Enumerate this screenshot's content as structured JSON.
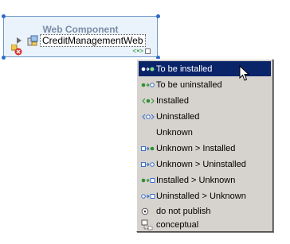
{
  "component": {
    "title": "Web Component",
    "name": "CreditManagementWeb"
  },
  "menu": {
    "items": [
      {
        "label": "To be installed",
        "icon": "to-be-installed-icon",
        "selected": true
      },
      {
        "label": "To be uninstalled",
        "icon": "to-be-uninstalled-icon",
        "selected": false
      },
      {
        "label": "Installed",
        "icon": "installed-icon",
        "selected": false
      },
      {
        "label": "Uninstalled",
        "icon": "uninstalled-icon",
        "selected": false
      },
      {
        "label": "Unknown",
        "icon": "",
        "selected": false
      },
      {
        "label": "Unknown > Installed",
        "icon": "unknown-installed-icon",
        "selected": false
      },
      {
        "label": "Unknown > Uninstalled",
        "icon": "unknown-uninstalled-icon",
        "selected": false
      },
      {
        "label": "Installed > Unknown",
        "icon": "installed-unknown-icon",
        "selected": false
      },
      {
        "label": "Uninstalled > Unknown",
        "icon": "uninstalled-unknown-icon",
        "selected": false
      },
      {
        "label": "do not publish",
        "icon": "do-not-publish-icon",
        "selected": false
      },
      {
        "label": "conceptual",
        "icon": "conceptual-icon",
        "selected": false
      }
    ]
  },
  "colors": {
    "selection": "#0a246a",
    "menu_bg": "#d6d3ce",
    "component_border": "#6d99c8",
    "component_bg": "#eaf2fb",
    "installed_green": "#2f8f2f",
    "uninstalled_blue": "#3a6fc8"
  }
}
